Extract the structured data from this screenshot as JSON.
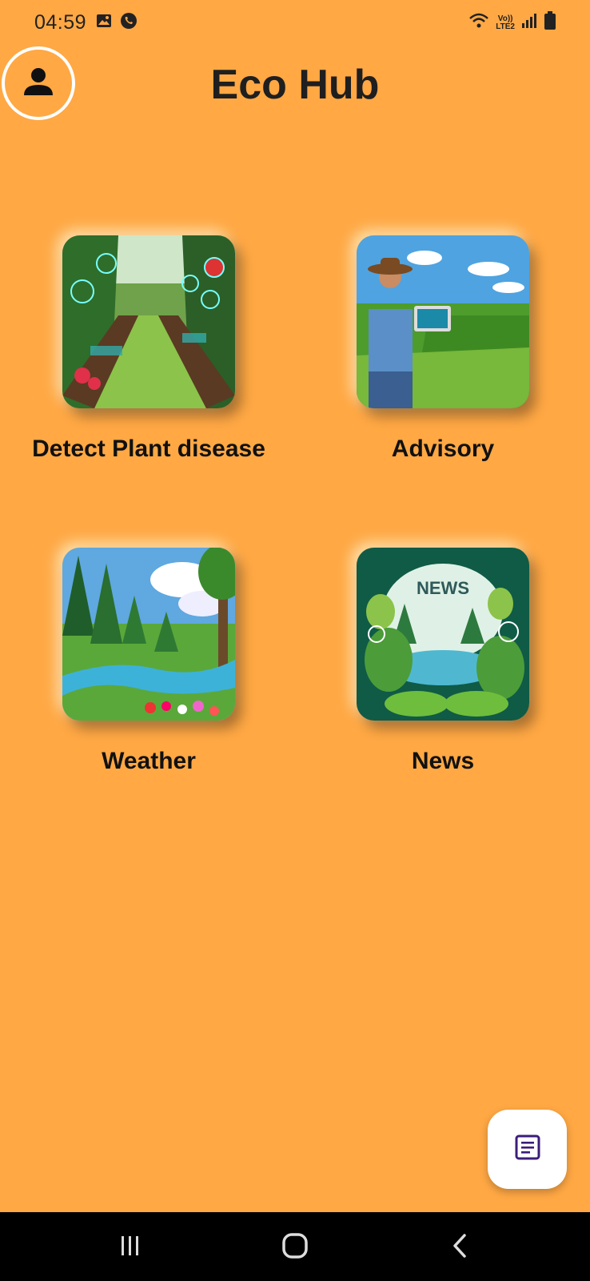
{
  "status_bar": {
    "time": "04:59",
    "network_label_top": "Vo))",
    "network_label_bottom": "LTE2",
    "icons": [
      "gallery-icon",
      "whatsapp-icon",
      "wifi-icon",
      "signal-icon",
      "battery-icon"
    ]
  },
  "header": {
    "title": "Eco Hub",
    "profile_icon": "person-icon"
  },
  "features": [
    {
      "label": "Detect Plant disease",
      "image": "smart-garden-image"
    },
    {
      "label": "Advisory",
      "image": "farmer-tablet-image"
    },
    {
      "label": "Weather",
      "image": "forest-river-image"
    },
    {
      "label": "News",
      "image": "nature-news-image"
    }
  ],
  "fab": {
    "icon": "article-icon"
  },
  "nav": {
    "items": [
      "recent-apps-icon",
      "home-icon",
      "back-icon"
    ]
  },
  "colors": {
    "background": "#FFA844",
    "fab_icon": "#3B1E7A"
  }
}
